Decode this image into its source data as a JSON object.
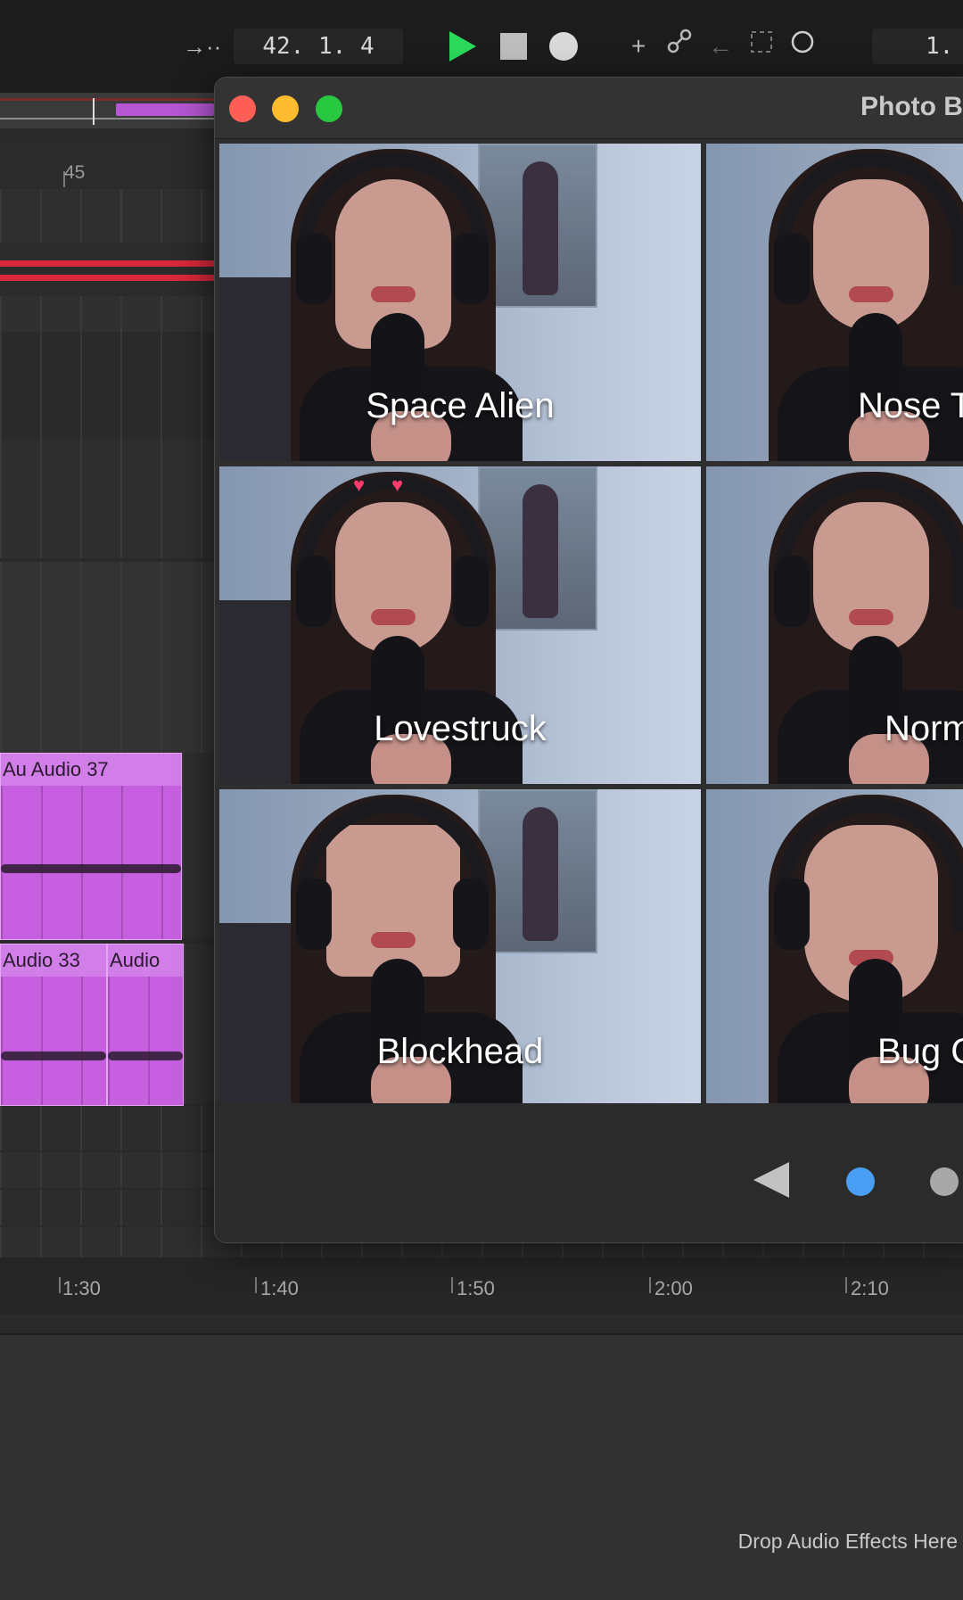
{
  "transport": {
    "position": "42. 1. 4",
    "position2": "1.",
    "follow_glyph": "→··"
  },
  "arrangement": {
    "bar_label": "45",
    "clips": [
      {
        "label": "Au Audio 37"
      },
      {
        "label": "Audio 33"
      },
      {
        "label": "Audio"
      }
    ],
    "time_labels": [
      "1:30",
      "1:40",
      "1:50",
      "2:00",
      "2:10"
    ]
  },
  "photo_booth": {
    "title": "Photo B",
    "effects": [
      "Space Alien",
      "Nose T",
      "Lovestruck",
      "Norm",
      "Blockhead",
      "Bug C"
    ]
  },
  "device_view": {
    "drop_hint": "Drop Audio Effects Here"
  },
  "colors": {
    "clip": "#c660e0",
    "play": "#2bd95b",
    "record_lane": "#d8283a",
    "close": "#ff5f57",
    "minimize": "#febc2e",
    "zoom": "#28c840",
    "page_active": "#4a9ff5"
  }
}
